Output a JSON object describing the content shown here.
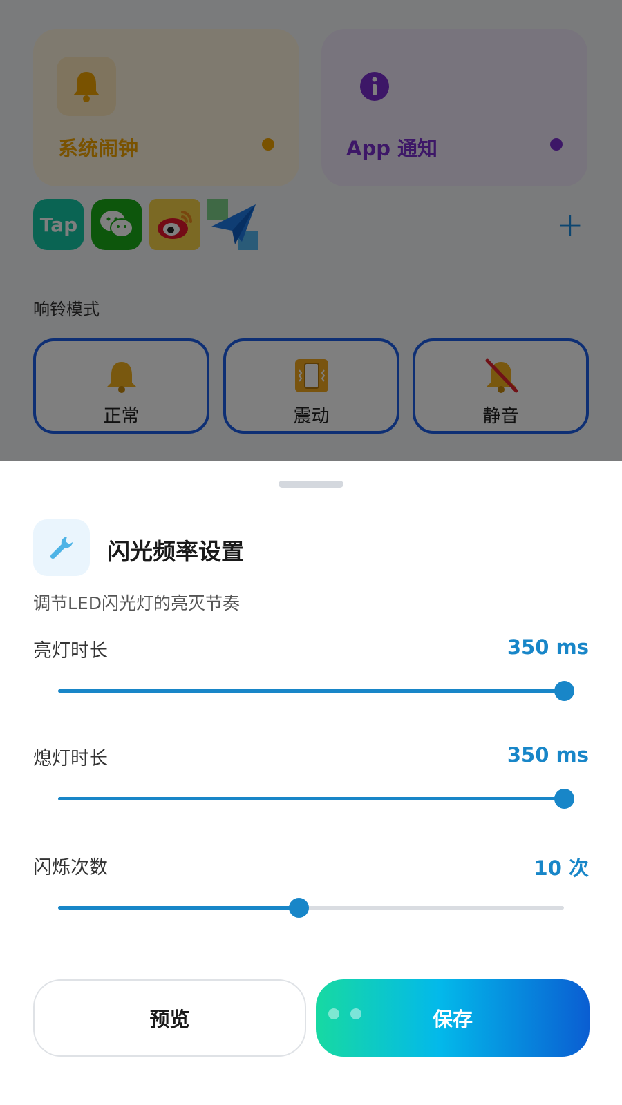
{
  "background": {
    "cards": [
      {
        "title": "系统闹钟",
        "icon": "bell-icon",
        "color": "#f2a400"
      },
      {
        "title": "App 通知",
        "icon": "info-icon",
        "color": "#7b2fcf"
      }
    ],
    "apps": [
      {
        "icon": "tap-app-icon",
        "label": "Tap"
      },
      {
        "icon": "wechat-app-icon"
      },
      {
        "icon": "weibo-app-icon"
      },
      {
        "icon": "paper-plane-app-icon"
      }
    ],
    "add_label": "+",
    "ring_mode_label": "响铃模式",
    "ring_modes": [
      {
        "label": "正常",
        "icon": "bell-icon"
      },
      {
        "label": "震动",
        "icon": "vibrate-icon"
      },
      {
        "label": "静音",
        "icon": "muted-bell-icon"
      }
    ]
  },
  "sheet": {
    "title": "闪光频率设置",
    "subtitle": "调节LED闪光灯的亮灭节奏",
    "icon": "wrench-icon",
    "settings": [
      {
        "label": "亮灯时长",
        "value": "350 ms",
        "fraction": 1.0
      },
      {
        "label": "熄灯时长",
        "value": "350 ms",
        "fraction": 1.0
      },
      {
        "label": "闪烁次数",
        "value": "10 次",
        "fraction": 0.475
      }
    ],
    "preview_label": "预览",
    "save_label": "保存"
  },
  "colors": {
    "accent": "#1886c8",
    "alarm": "#f2a400",
    "notify": "#7b2fcf",
    "mode_border": "#1d5ee8"
  }
}
